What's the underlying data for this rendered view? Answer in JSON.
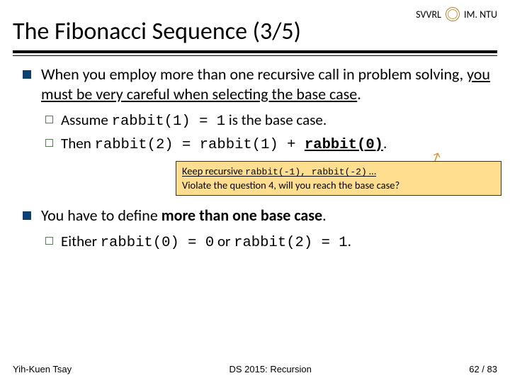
{
  "header": {
    "svvrl": "SVVRL",
    "im_ntu": "IM. NTU",
    "title": "The Fibonacci Sequence (3/5)"
  },
  "bullets": {
    "b1_pre": "When you employ more than one recursive call in problem solving, ",
    "b1_u": "you must be very careful when selecting the base case",
    "b1_post": ".",
    "b1_1_pre": "Assume ",
    "b1_1_code": "rabbit(1) = 1",
    "b1_1_post": " is the base case.",
    "b1_2_pre": "Then ",
    "b1_2_code1": "rabbit(2) = rabbit(1) + ",
    "b1_2_code2": "rabbit(0)",
    "b1_2_post": ".",
    "b2_pre": "You have to define ",
    "b2_bold": "more than one base case",
    "b2_post": ".",
    "b2_1_pre": "Either ",
    "b2_1_code1": "rabbit(0) = 0",
    "b2_1_mid": " or ",
    "b2_1_code2": "rabbit(2) = 1",
    "b2_1_post": "."
  },
  "callout": {
    "line1_a": "Keep recursive ",
    "line1_code": "rabbit(-1), rabbit(-2)",
    "line1_b": " …",
    "line2_a": "Violate the question 4, ",
    "line2_b": "will you reach the base case?"
  },
  "footer": {
    "author": "Yih-Kuen Tsay",
    "course": "DS 2015: Recursion",
    "page": "62 / 83"
  }
}
